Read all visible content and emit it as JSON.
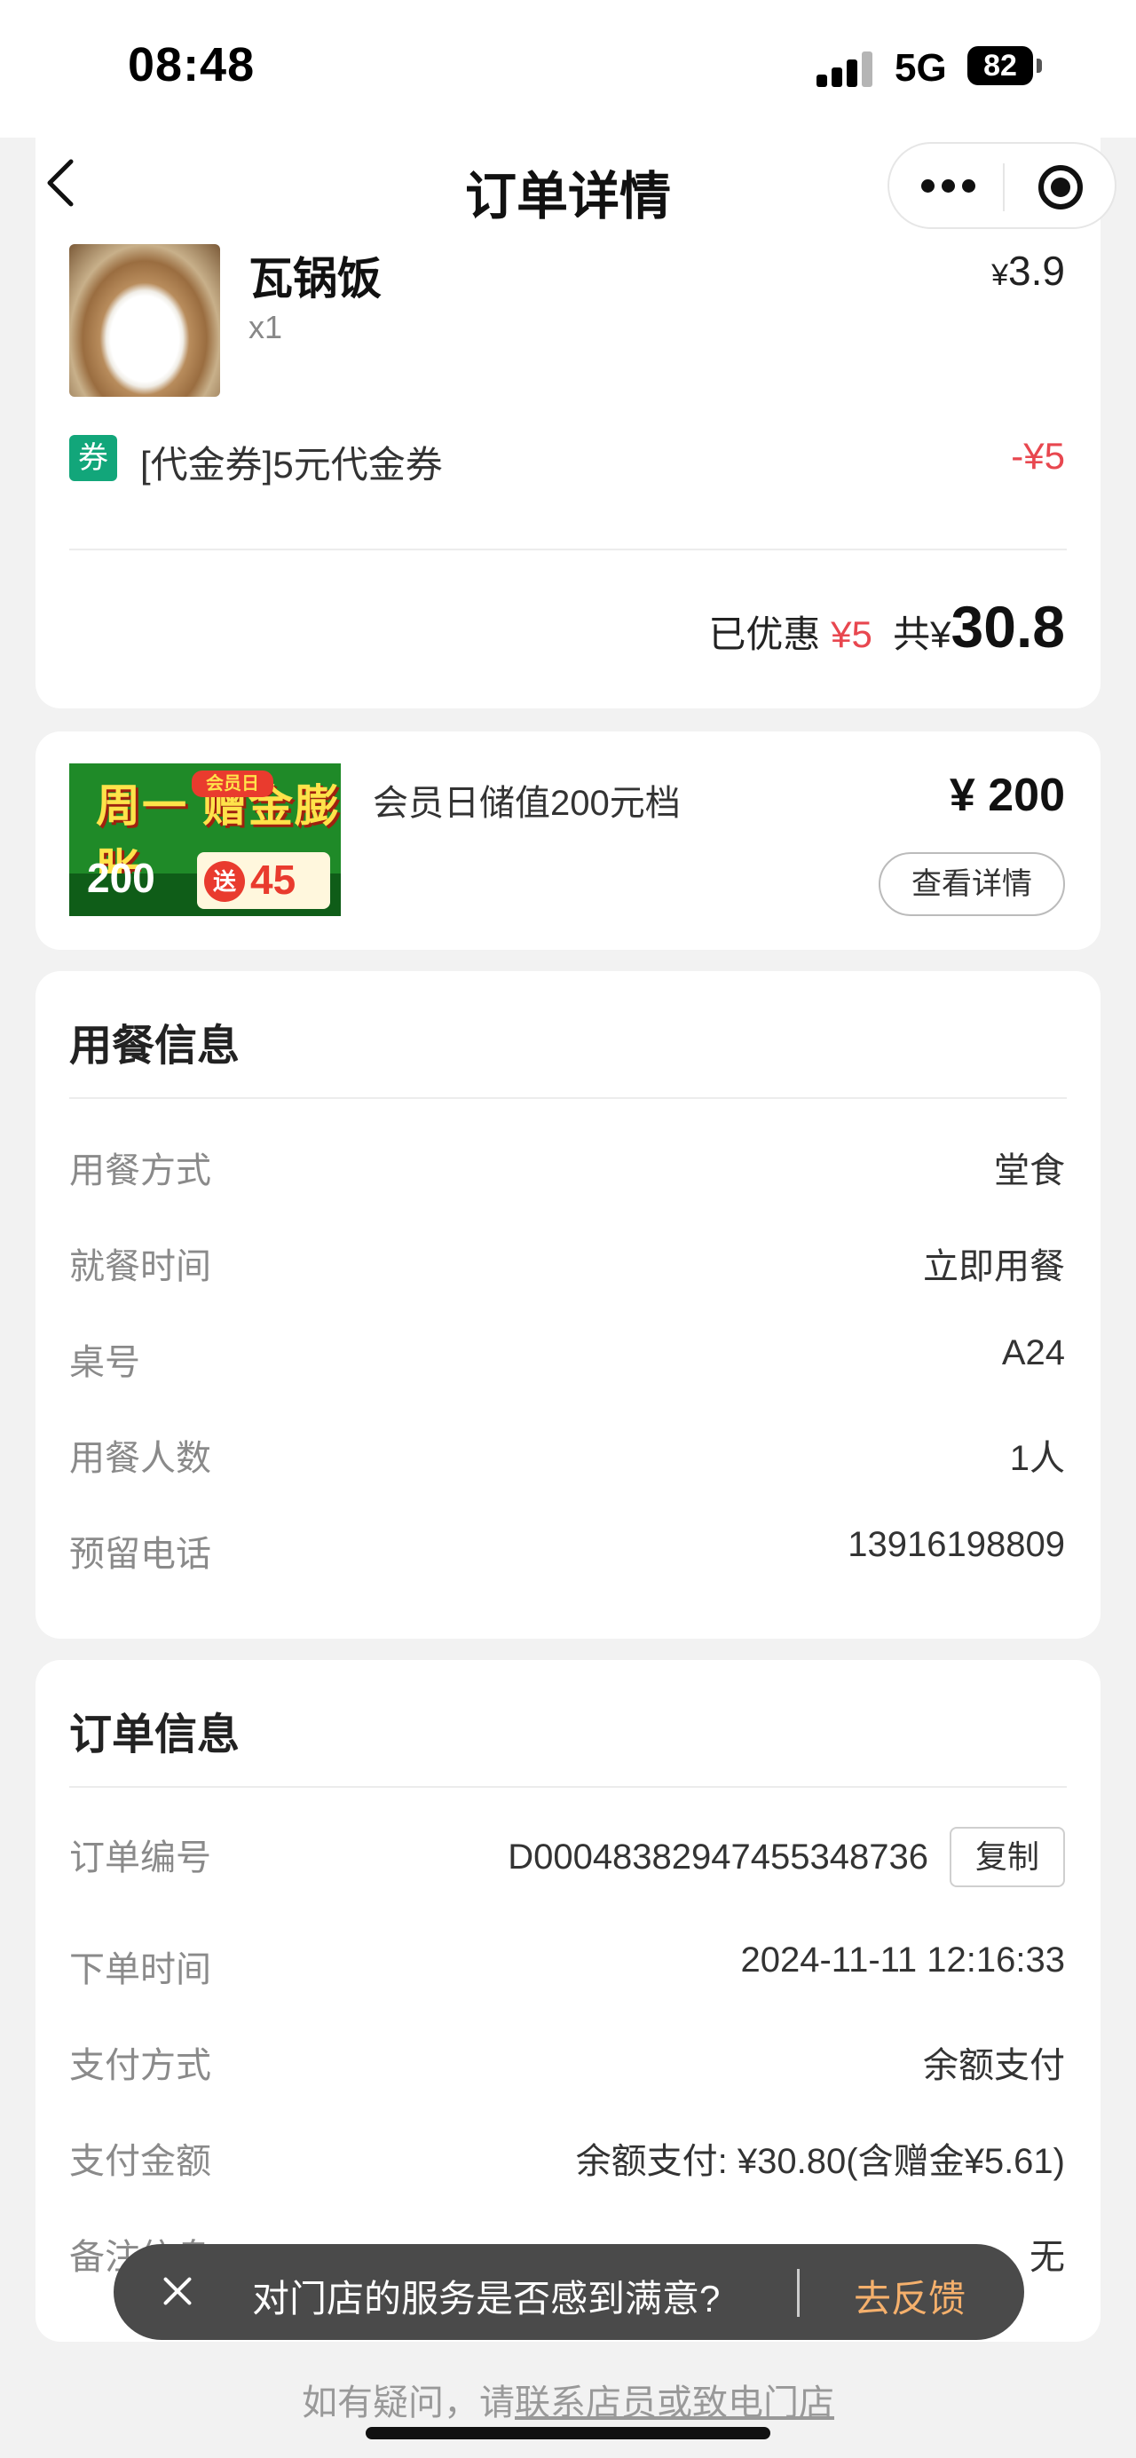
{
  "status_bar": {
    "time": "08:48",
    "network": "5G",
    "battery": "82"
  },
  "nav": {
    "title": "订单详情"
  },
  "order_item": {
    "name": "瓦锅饭",
    "qty": "x1",
    "currency": "¥",
    "price": "3.9"
  },
  "coupon": {
    "tag": "券",
    "name": "[代金券]5元代金券",
    "amount": "-¥5"
  },
  "summary": {
    "discount_label": "已优惠",
    "discount_value": "¥5",
    "total_label": "共",
    "currency": "¥",
    "total": "30.8"
  },
  "promo": {
    "image_text": {
      "headline": "周一 赠金膨胀",
      "badge": "会员日",
      "base": "200",
      "gift_word": "送",
      "gift": "45"
    },
    "name": "会员日储值200元档",
    "price": "¥ 200",
    "detail_button": "查看详情"
  },
  "dining_info": {
    "title": "用餐信息",
    "rows": [
      {
        "label": "用餐方式",
        "value": "堂食"
      },
      {
        "label": "就餐时间",
        "value": "立即用餐"
      },
      {
        "label": "桌号",
        "value": "A24"
      },
      {
        "label": "用餐人数",
        "value": "1人"
      },
      {
        "label": "预留电话",
        "value": "13916198809"
      }
    ]
  },
  "order_info": {
    "title": "订单信息",
    "copy_button": "复制",
    "rows": [
      {
        "label": "订单编号",
        "value": "D00048382947455348736"
      },
      {
        "label": "下单时间",
        "value": "2024-11-11 12:16:33"
      },
      {
        "label": "支付方式",
        "value": "余额支付"
      },
      {
        "label": "支付金额",
        "value": "余额支付: ¥30.80(含赠金¥5.61)"
      },
      {
        "label": "备注信息",
        "value": "无"
      }
    ]
  },
  "toast": {
    "message": "对门店的服务是否感到满意?",
    "action": "去反馈"
  },
  "footer": {
    "prefix": "如有疑问，请",
    "link": "联系店员或致电门店"
  }
}
